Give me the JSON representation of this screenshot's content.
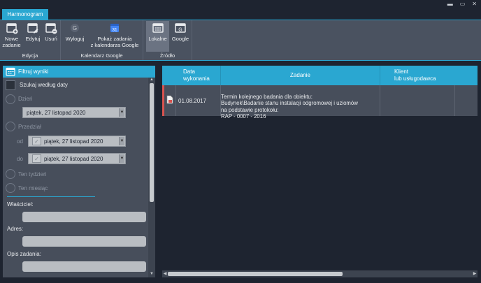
{
  "window": {
    "tab": "Harmonogram",
    "controls": [
      "▬",
      "▭",
      "✕"
    ]
  },
  "ribbon": {
    "groups": [
      {
        "label": "Edycja",
        "buttons": [
          {
            "label": "Nowe\nzadanie",
            "icon": "calendar-add-icon"
          },
          {
            "label": "Edytuj",
            "icon": "calendar-edit-icon"
          },
          {
            "label": "Usuń",
            "icon": "calendar-delete-icon"
          }
        ]
      },
      {
        "label": "Kalendarz Google",
        "buttons": [
          {
            "label": "Wyloguj",
            "icon": "google-logout-icon"
          },
          {
            "label": "Pokaż zadania\nz kalendarza Google",
            "icon": "google-calendar-icon"
          }
        ]
      },
      {
        "label": "Źródło",
        "buttons": [
          {
            "label": "Lokalne",
            "icon": "local-calendar-icon",
            "active": true
          },
          {
            "label": "Google",
            "icon": "google-source-icon"
          }
        ]
      }
    ]
  },
  "filter": {
    "title": "Filtruj wyniki",
    "search_by_date": "Szukaj według daty",
    "day_label": "Dzień",
    "day_value": "piątek, 27 listopad  2020",
    "range_label": "Przedział",
    "from_label": "od",
    "from_value": "piątek, 27 listopad  2020",
    "to_label": "do",
    "to_value": "piątek, 27 listopad  2020",
    "this_week": "Ten tydzień",
    "this_month": "Ten miesiąc",
    "owner_label": "Właściciel:",
    "address_label": "Adres:",
    "desc_label": "Opis zadania:"
  },
  "grid": {
    "columns": [
      "Data\nwykonania",
      "Zadanie",
      "Klient\nlub usługodawca"
    ],
    "rows": [
      {
        "date": "01.08.2017",
        "task": "Termin kolejnego badania dla obiektu:\n Budynek\\Badanie stanu instalacji odgromowej i uziomów\nna podstawie protokołu:\n RAP - 0007 - 2016",
        "client": ""
      }
    ]
  },
  "colors": {
    "accent": "#2aa7d1",
    "ribbon": "#4a5260",
    "panel": "#474e5b",
    "background": "#1e2430"
  }
}
